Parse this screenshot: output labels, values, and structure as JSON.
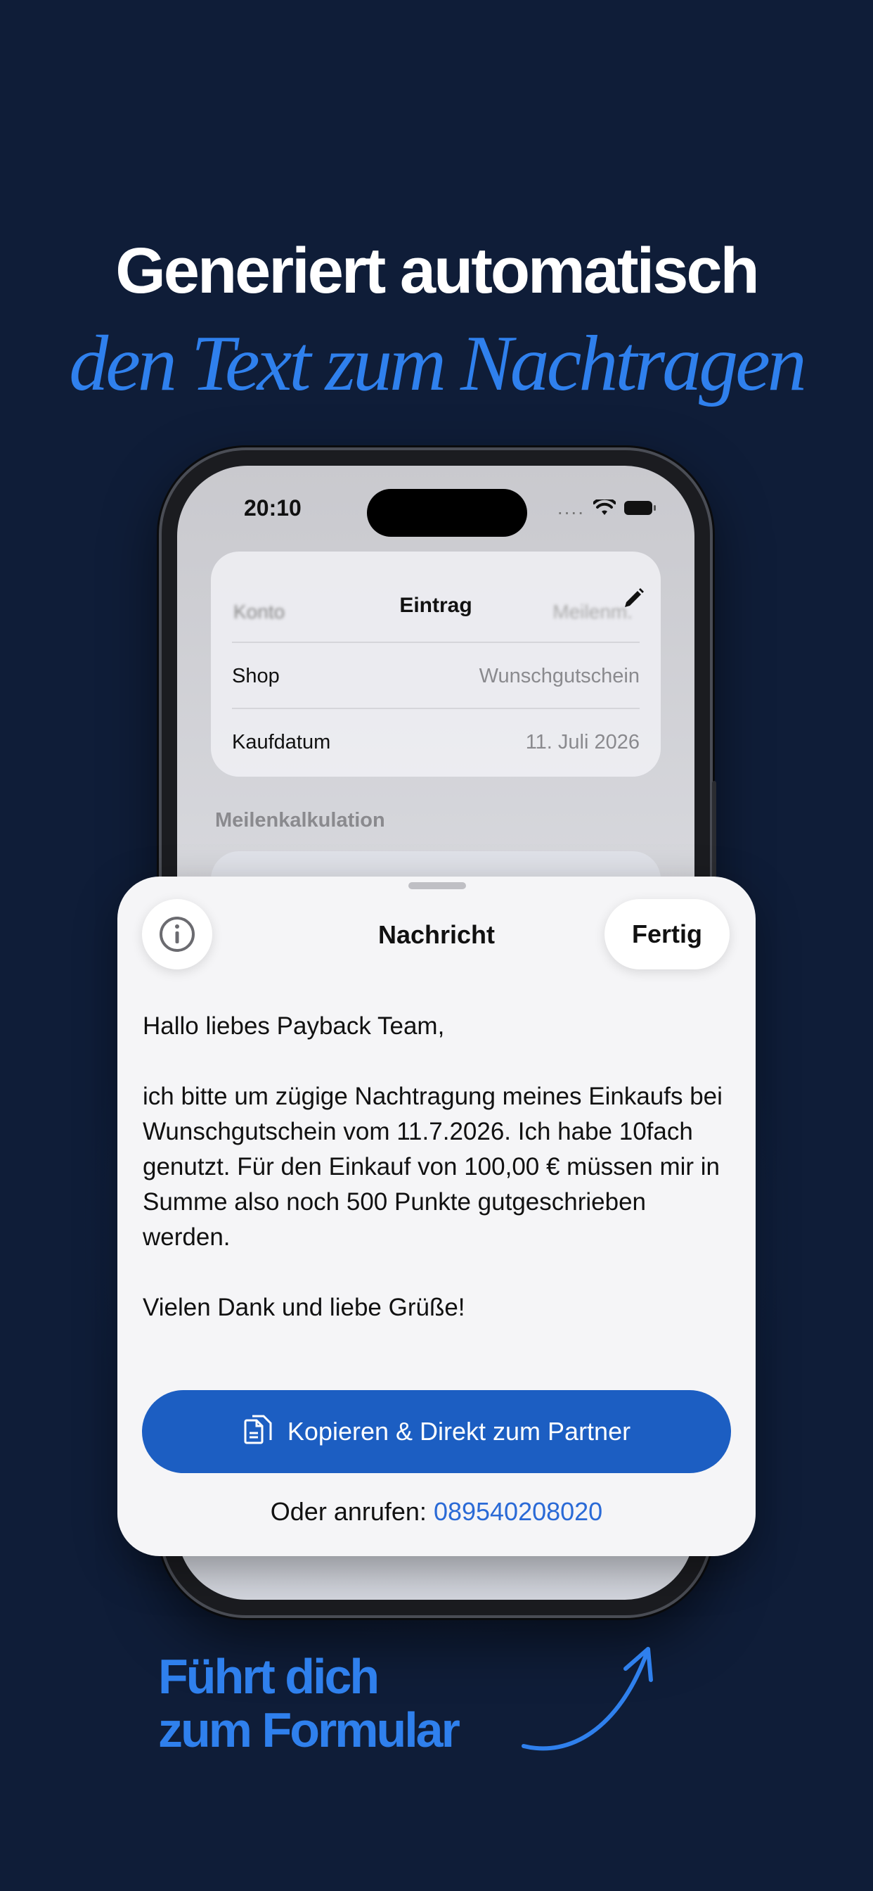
{
  "headline": {
    "line1": "Generiert automatisch",
    "line2": "den Text zum Nachtragen"
  },
  "status_bar": {
    "time": "20:10",
    "signal": "...."
  },
  "entry_card": {
    "title": "Eintrag",
    "blurred_left": "Konto",
    "blurred_right": "Meilenm.",
    "rows": [
      {
        "label": "Shop",
        "value": "Wunschgutschein"
      },
      {
        "label": "Kaufdatum",
        "value": "11. Juli 2026"
      }
    ],
    "section_label": "Meilenkalkulation"
  },
  "sheet": {
    "title": "Nachricht",
    "done_label": "Fertig",
    "message": {
      "greeting": "Hallo liebes Payback Team,",
      "body": "ich bitte um zügige Nachtragung meines Einkaufs bei Wunschgutschein vom 11.7.2026. Ich habe 10fach genutzt. Für den Einkauf von 100,00 € müssen mir in Summe also noch 500 Punkte gutgeschrieben werden.",
      "closing": "Vielen Dank und liebe Grüße!"
    },
    "cta_label": "Kopieren & Direkt zum Partner",
    "call_prefix": "Oder anrufen:",
    "call_number": "089540208020"
  },
  "caption": {
    "line1": "Führt dich",
    "line2": "zum Formular"
  },
  "colors": {
    "background": "#0f1d38",
    "accent": "#2f80ed",
    "cta": "#1c5ec2"
  },
  "icons": [
    "edit-pencil-icon",
    "info-icon",
    "copy-document-icon",
    "wifi-icon",
    "battery-icon",
    "curved-arrow-icon"
  ]
}
